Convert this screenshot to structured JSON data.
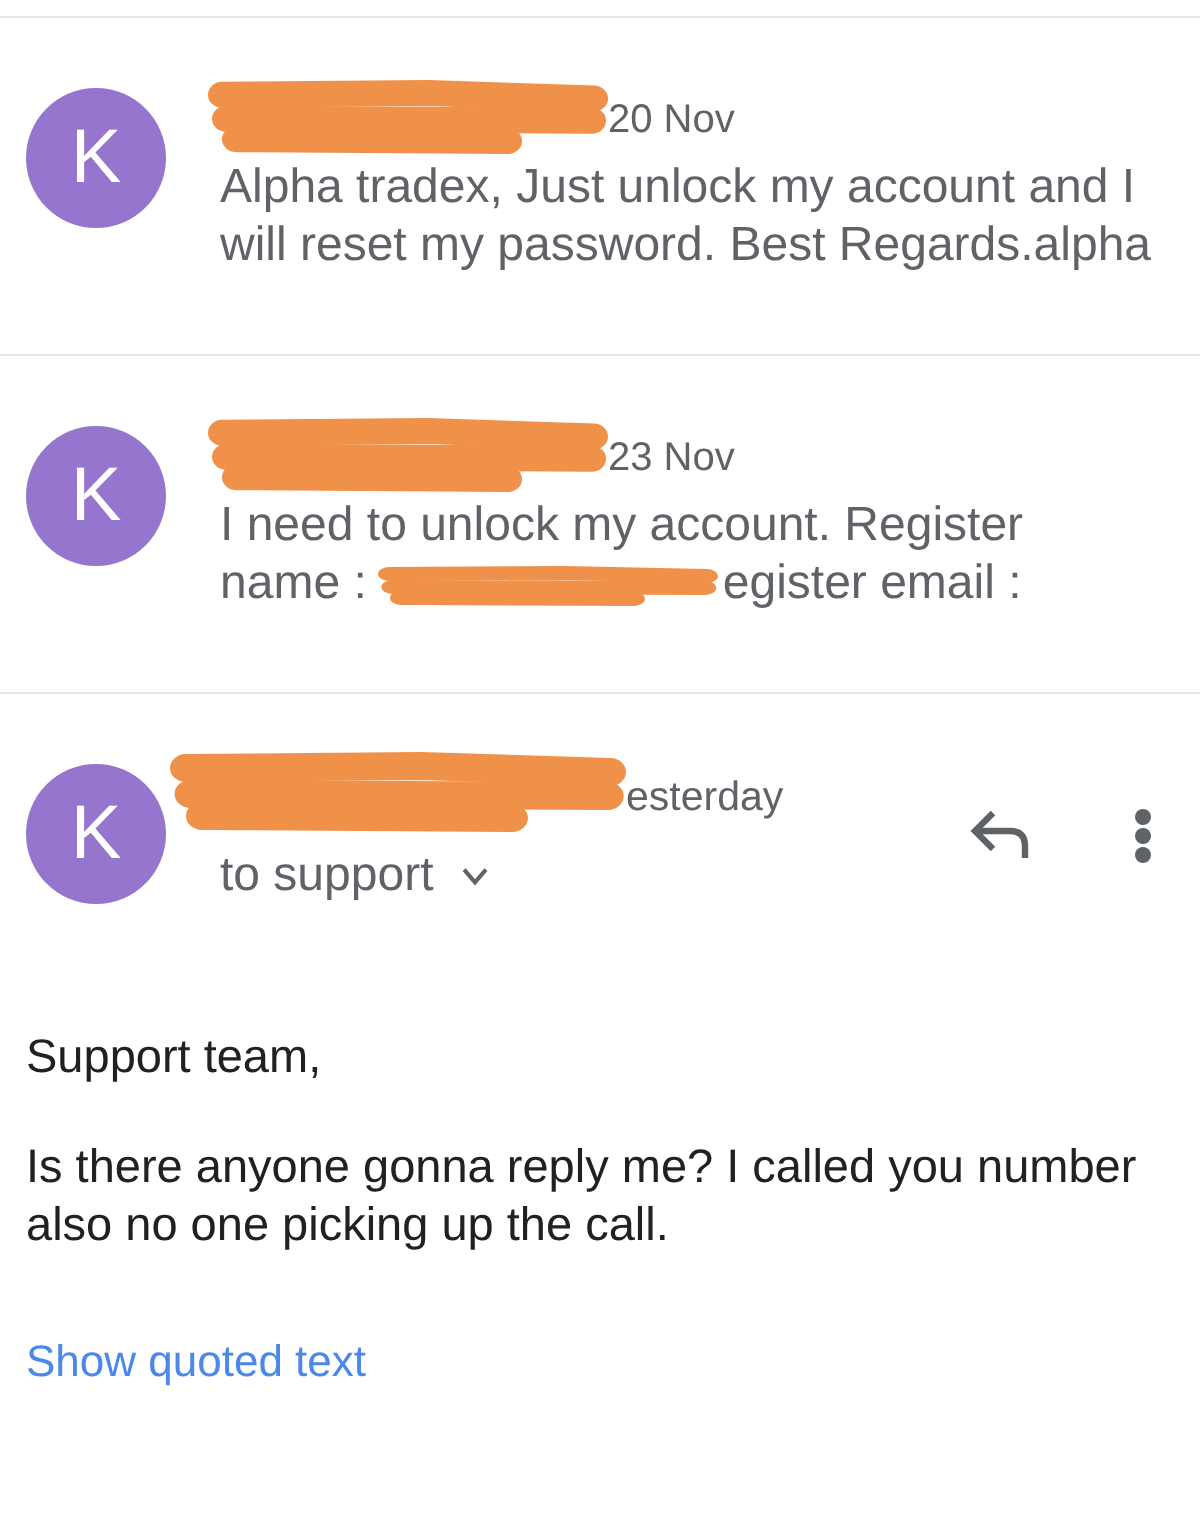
{
  "messages": [
    {
      "kind": "collapsed",
      "avatar": "K",
      "sender": {
        "redacted": true
      },
      "date": "20 Nov",
      "preview": [
        {
          "parts": [
            {
              "kind": "text",
              "text": "Alpha tradex, Just unlock my account and I will reset my password. Best Regards.alpha"
            }
          ]
        }
      ]
    },
    {
      "kind": "collapsed",
      "avatar": "K",
      "sender": {
        "redacted": true
      },
      "date": "23 Nov",
      "preview": [
        {
          "parts": [
            {
              "kind": "text",
              "text": "I need to unlock my account. Register"
            }
          ]
        },
        {
          "parts": [
            {
              "kind": "text",
              "text": "name :"
            },
            {
              "kind": "redaction"
            },
            {
              "kind": "text",
              "text": "egister email :"
            }
          ]
        }
      ]
    },
    {
      "kind": "expanded",
      "avatar": "K",
      "sender": {
        "redacted": true
      },
      "date": "esterday",
      "recipients": "to support",
      "recipients_expanded": false,
      "actions": [
        {
          "kind": "reply"
        },
        {
          "kind": "more"
        }
      ],
      "body": [
        "Support team,",
        "Is there anyone gonna reply me? I called you number also no one picking up the call."
      ],
      "quoted_link": "Show quoted text"
    }
  ]
}
